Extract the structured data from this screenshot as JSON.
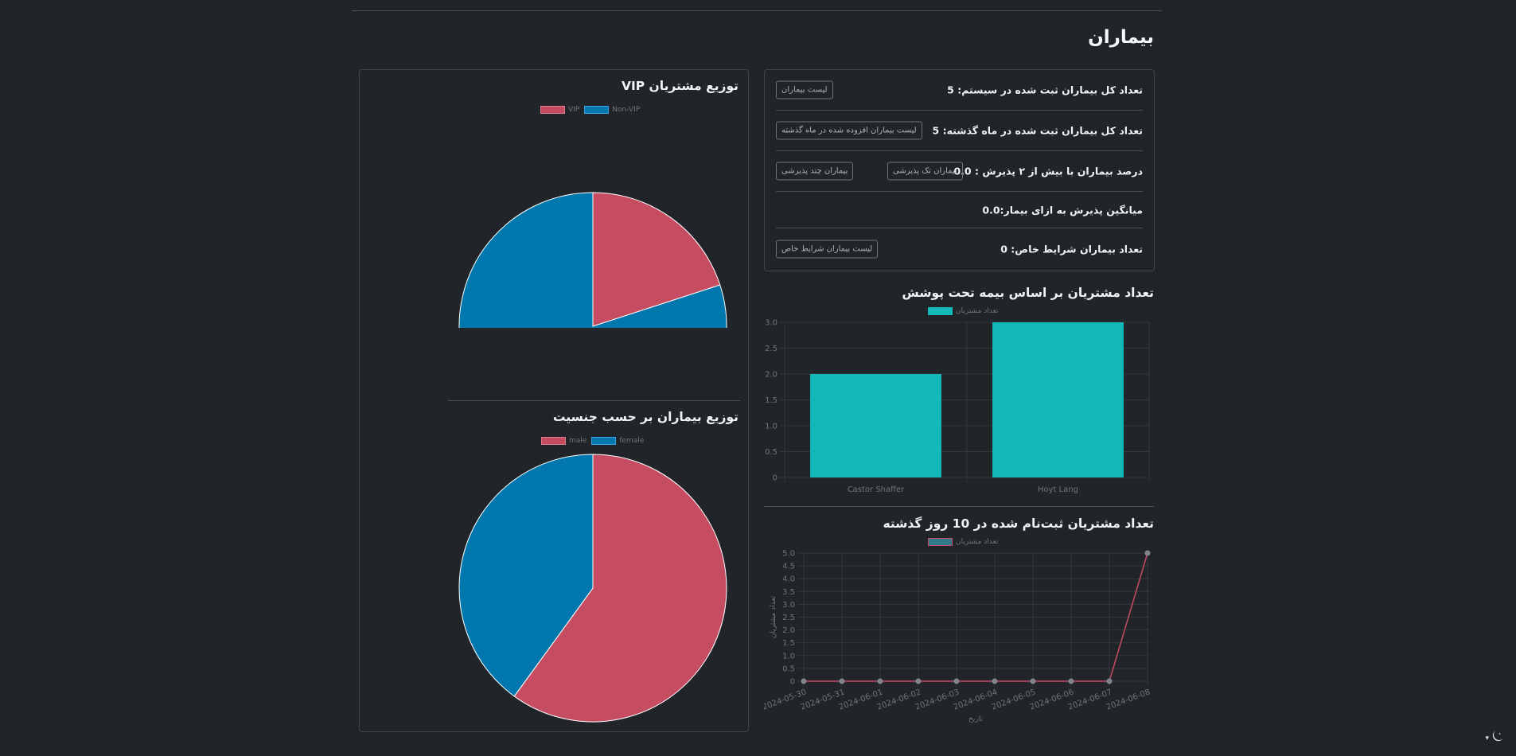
{
  "page": {
    "title": "بیماران"
  },
  "stats": [
    {
      "label": "تعداد کل بیماران ثبت شده در سیستم: 5",
      "buttons": [
        "لیست بیماران"
      ]
    },
    {
      "label": "تعداد کل بیماران ثبت شده در ماه گذشته: 5",
      "buttons": [
        "لیست بیماران افزوده شده در ماه گذشته"
      ]
    },
    {
      "label": "درصد بیماران با بیش از ۲ پذیرش : 0.0",
      "buttons": [
        "بیماران تک پذیرشی",
        "بیماران چند پذیرشی"
      ]
    },
    {
      "label": "میانگین پذیرش به ازای بیمار:0.0",
      "buttons": []
    },
    {
      "label": "تعداد بیماران شرایط خاص: 0",
      "buttons": [
        "لیست بیماران شرایط خاص"
      ]
    }
  ],
  "theme": {
    "toggle_icon": "moon-icon",
    "caret": "▾"
  },
  "colors": {
    "pink": "#c64c62",
    "blue": "#0077ad",
    "teal": "#15b8b9",
    "line": "#c64c62",
    "grid": "#343a40",
    "axis_text": "#6c757d"
  },
  "chart_data": [
    {
      "type": "pie",
      "title": "توزیع مشتریان VIP",
      "labels": [
        "VIP",
        "Non-VIP"
      ],
      "values": [
        1,
        4
      ],
      "colors": [
        "#c64c62",
        "#0077ad"
      ],
      "legend": "top"
    },
    {
      "type": "pie",
      "title": "توزیع بیماران بر حسب جنسیت",
      "labels": [
        "male",
        "female"
      ],
      "values": [
        3,
        2
      ],
      "colors": [
        "#c64c62",
        "#0077ad"
      ],
      "legend": "top"
    },
    {
      "type": "bar",
      "title": "تعداد مشتریان بر اساس بیمه تحت پوشش",
      "categories": [
        "Castor Shaffer",
        "Hoyt Lang"
      ],
      "series": [
        {
          "name": "تعداد مشتریان",
          "values": [
            2,
            3
          ]
        }
      ],
      "ylim": [
        0,
        3
      ],
      "yticks": [
        "0",
        "0.5",
        "1.0",
        "1.5",
        "2.0",
        "2.5",
        "3.0"
      ],
      "color": "#15b8b9",
      "legend": "top",
      "grid": true
    },
    {
      "type": "line",
      "title": "تعداد مشتریان ثبت‌نام شده در 10 روز گذشته",
      "x": [
        "2024-05-30",
        "2024-05-31",
        "2024-06-01",
        "2024-06-02",
        "2024-06-03",
        "2024-06-04",
        "2024-06-05",
        "2024-06-06",
        "2024-06-07",
        "2024-06-08"
      ],
      "series": [
        {
          "name": "تعداد مشتریان",
          "values": [
            0,
            0,
            0,
            0,
            0,
            0,
            0,
            0,
            0,
            5
          ]
        }
      ],
      "ylim": [
        0,
        5
      ],
      "yticks": [
        "0",
        "0.5",
        "1.0",
        "1.5",
        "2.0",
        "2.5",
        "3.0",
        "3.5",
        "4.0",
        "4.5",
        "5.0"
      ],
      "xlabel": "تاریخ",
      "ylabel": "تعداد مشتریان",
      "legend": "top",
      "grid": true
    }
  ]
}
